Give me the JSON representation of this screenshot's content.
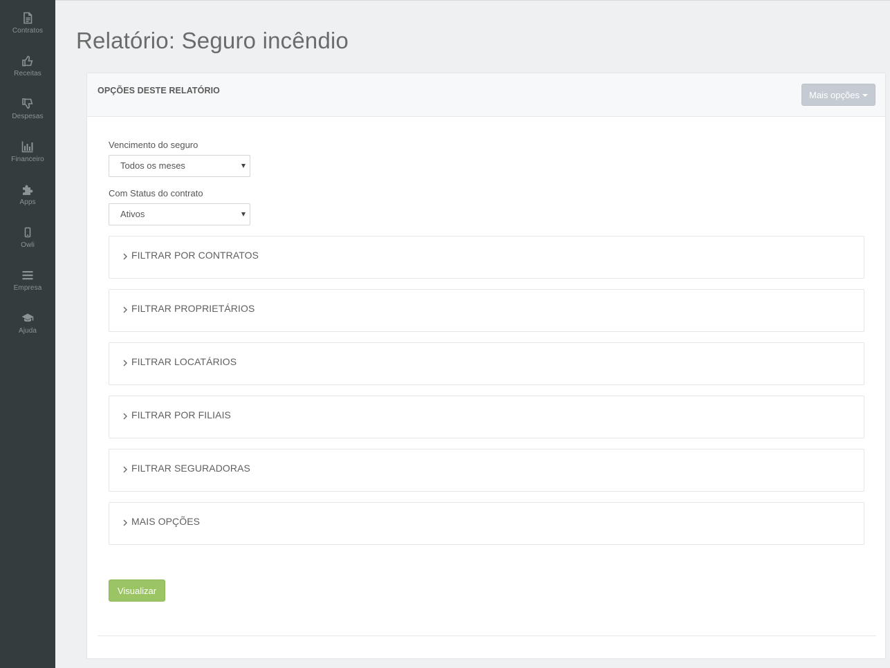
{
  "sidebar": {
    "items": [
      {
        "label": "Contratos",
        "icon": "document-icon"
      },
      {
        "label": "Receitas",
        "icon": "thumbs-up-icon"
      },
      {
        "label": "Despesas",
        "icon": "thumbs-down-icon"
      },
      {
        "label": "Financeiro",
        "icon": "bar-chart-icon"
      },
      {
        "label": "Apps",
        "icon": "puzzle-icon"
      },
      {
        "label": "Owli",
        "icon": "mobile-icon"
      },
      {
        "label": "Empresa",
        "icon": "menu-icon"
      },
      {
        "label": "Ajuda",
        "icon": "graduation-cap-icon"
      }
    ]
  },
  "page": {
    "title": "Relatório: Seguro incêndio"
  },
  "panel": {
    "heading": "OPÇÕES DESTE RELATÓRIO",
    "more_options_label": "Mais opções",
    "fields": [
      {
        "label": "Vencimento do seguro",
        "value": "Todos os meses"
      },
      {
        "label": "Com Status do contrato",
        "value": "Ativos"
      }
    ],
    "filters": [
      "FILTRAR POR CONTRATOS",
      "FILTRAR PROPRIETÁRIOS",
      "FILTRAR LOCATÁRIOS",
      "FILTRAR POR FILIAIS",
      "FILTRAR SEGURADORAS",
      "MAIS OPÇÕES"
    ],
    "submit_label": "Visualizar"
  },
  "colors": {
    "sidebar_bg": "#353c3e",
    "page_bg": "#eef0f2",
    "submit_green": "#9bc464",
    "more_btn_gray": "#c5cbd2"
  }
}
